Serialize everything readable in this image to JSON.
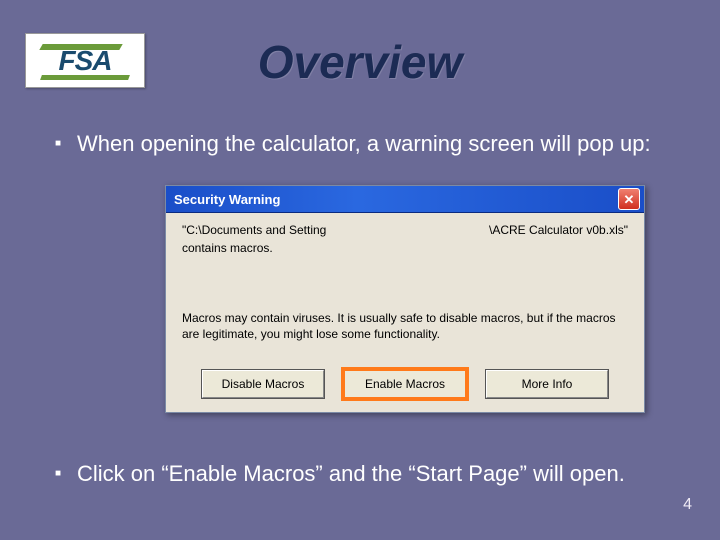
{
  "logo": {
    "text": "FSA"
  },
  "title": "Overview",
  "bullets": [
    {
      "text": "When opening the calculator, a warning screen will pop up:"
    },
    {
      "text": "Click on “Enable Macros” and the “Start Page” will open."
    }
  ],
  "dialog": {
    "title": "Security Warning",
    "path_left": "\"C:\\Documents and Setting",
    "path_right": "\\ACRE Calculator v0b.xls\"",
    "contains": "contains macros.",
    "note": "Macros may contain viruses. It is usually safe to disable macros, but if the macros are legitimate, you might lose some functionality.",
    "buttons": {
      "disable": "Disable Macros",
      "enable": "Enable Macros",
      "more": "More Info"
    }
  },
  "page_number": "4"
}
